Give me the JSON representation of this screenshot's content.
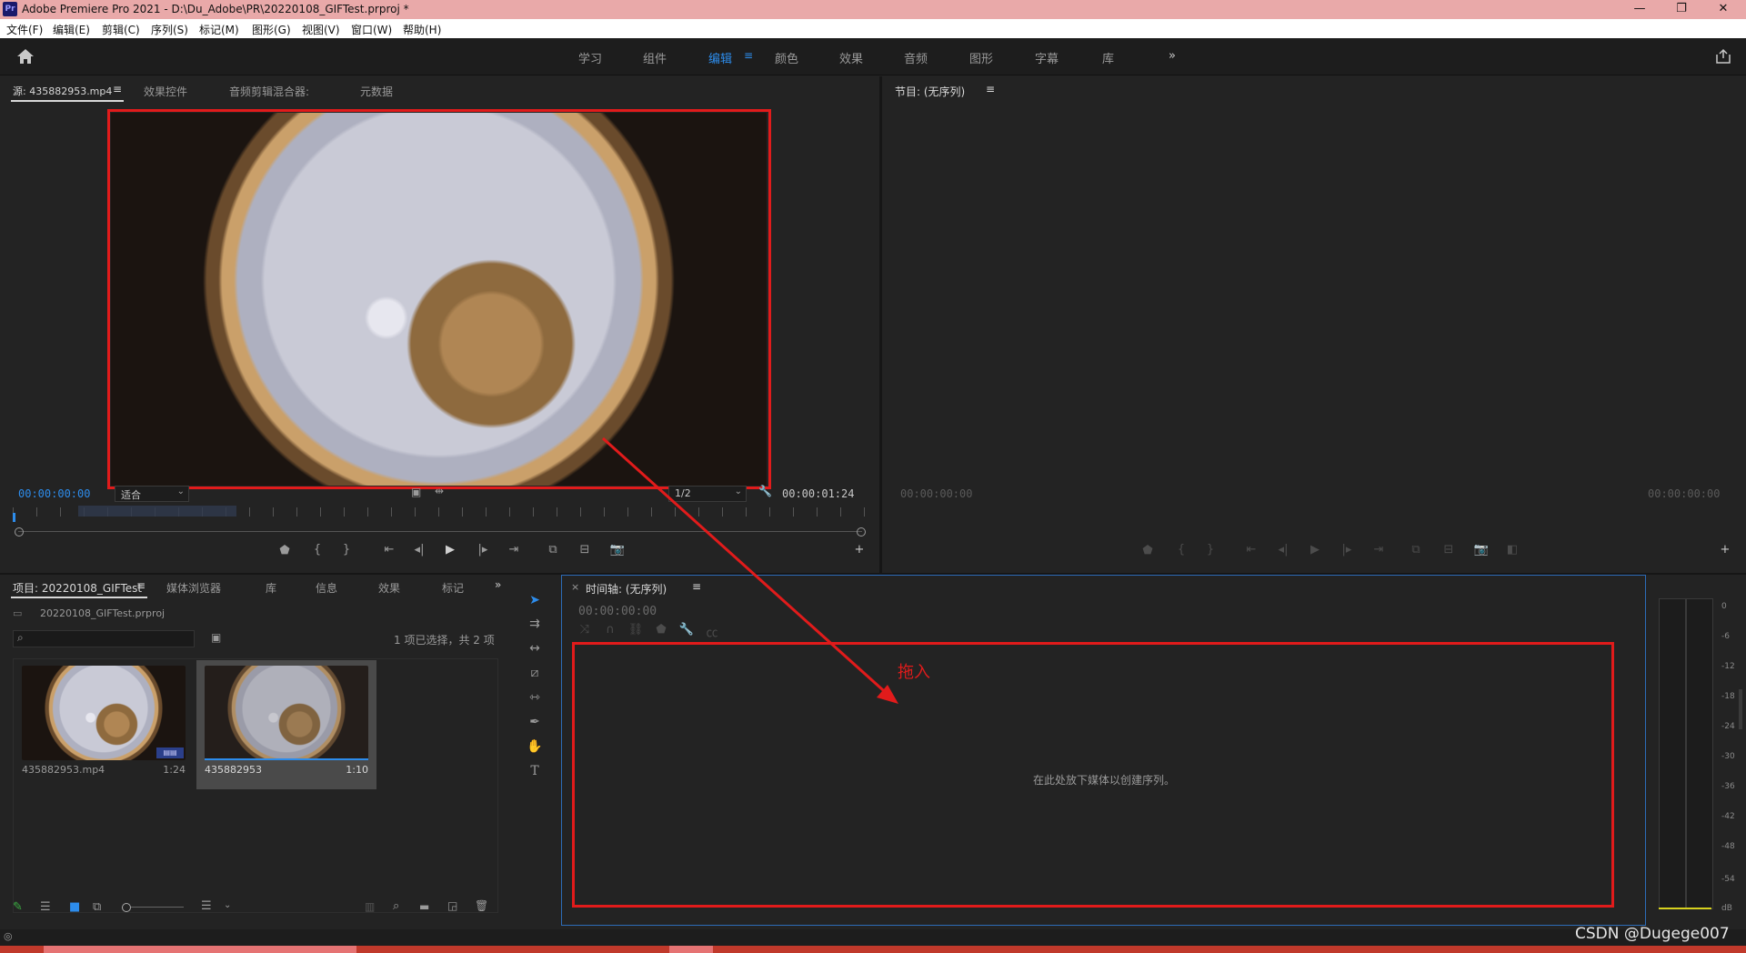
{
  "window": {
    "app_logo": "Pr",
    "title": "Adobe Premiere Pro 2021 - D:\\Du_Adobe\\PR\\20220108_GIFTest.prproj *",
    "controls": [
      "—",
      "❐",
      "✕"
    ]
  },
  "menu": [
    "文件(F)",
    "编辑(E)",
    "剪辑(C)",
    "序列(S)",
    "标记(M)",
    "图形(G)",
    "视图(V)",
    "窗口(W)",
    "帮助(H)"
  ],
  "workspaces": {
    "items": [
      "学习",
      "组件",
      "编辑",
      "颜色",
      "效果",
      "音频",
      "图形",
      "字幕",
      "库"
    ],
    "active": "编辑",
    "more": "»"
  },
  "source_panel": {
    "tabs": [
      "源: 435882953.mp4",
      "效果控件",
      "音频剪辑混合器:",
      "元数据"
    ],
    "timecode_in": "00:00:00:00",
    "fit": "适合",
    "resolution": "1/2",
    "duration": "00:00:01:24"
  },
  "program_panel": {
    "title": "节目: (无序列)",
    "timecode_left": "00:00:00:00",
    "timecode_right": "00:00:00:00"
  },
  "project_panel": {
    "tabs": [
      "项目: 20220108_GIFTest",
      "媒体浏览器",
      "库",
      "信息",
      "效果",
      "标记"
    ],
    "project_file": "20220108_GIFTest.prproj",
    "selection_status": "1 项已选择，共 2 项",
    "items": [
      {
        "name": "435882953.mp4",
        "duration": "1:24"
      },
      {
        "name": "435882953",
        "duration": "1:10"
      }
    ]
  },
  "timeline_panel": {
    "title": "时间轴: (无序列)",
    "timecode": "00:00:00:00",
    "drop_hint": "在此处放下媒体以创建序列。"
  },
  "annotation": {
    "label": "拖入",
    "color": "#e11b1b"
  },
  "audio_meter": {
    "scale": [
      "0",
      "-6",
      "-12",
      "-18",
      "-24",
      "-30",
      "-36",
      "-42",
      "-48",
      "-54",
      "dB"
    ]
  },
  "watermark": "CSDN @Dugege007",
  "colors": {
    "accent": "#2d8ceb",
    "annotation_red": "#e11b1b",
    "panel_bg": "#232323",
    "title_bar": "#e9a9a9"
  }
}
